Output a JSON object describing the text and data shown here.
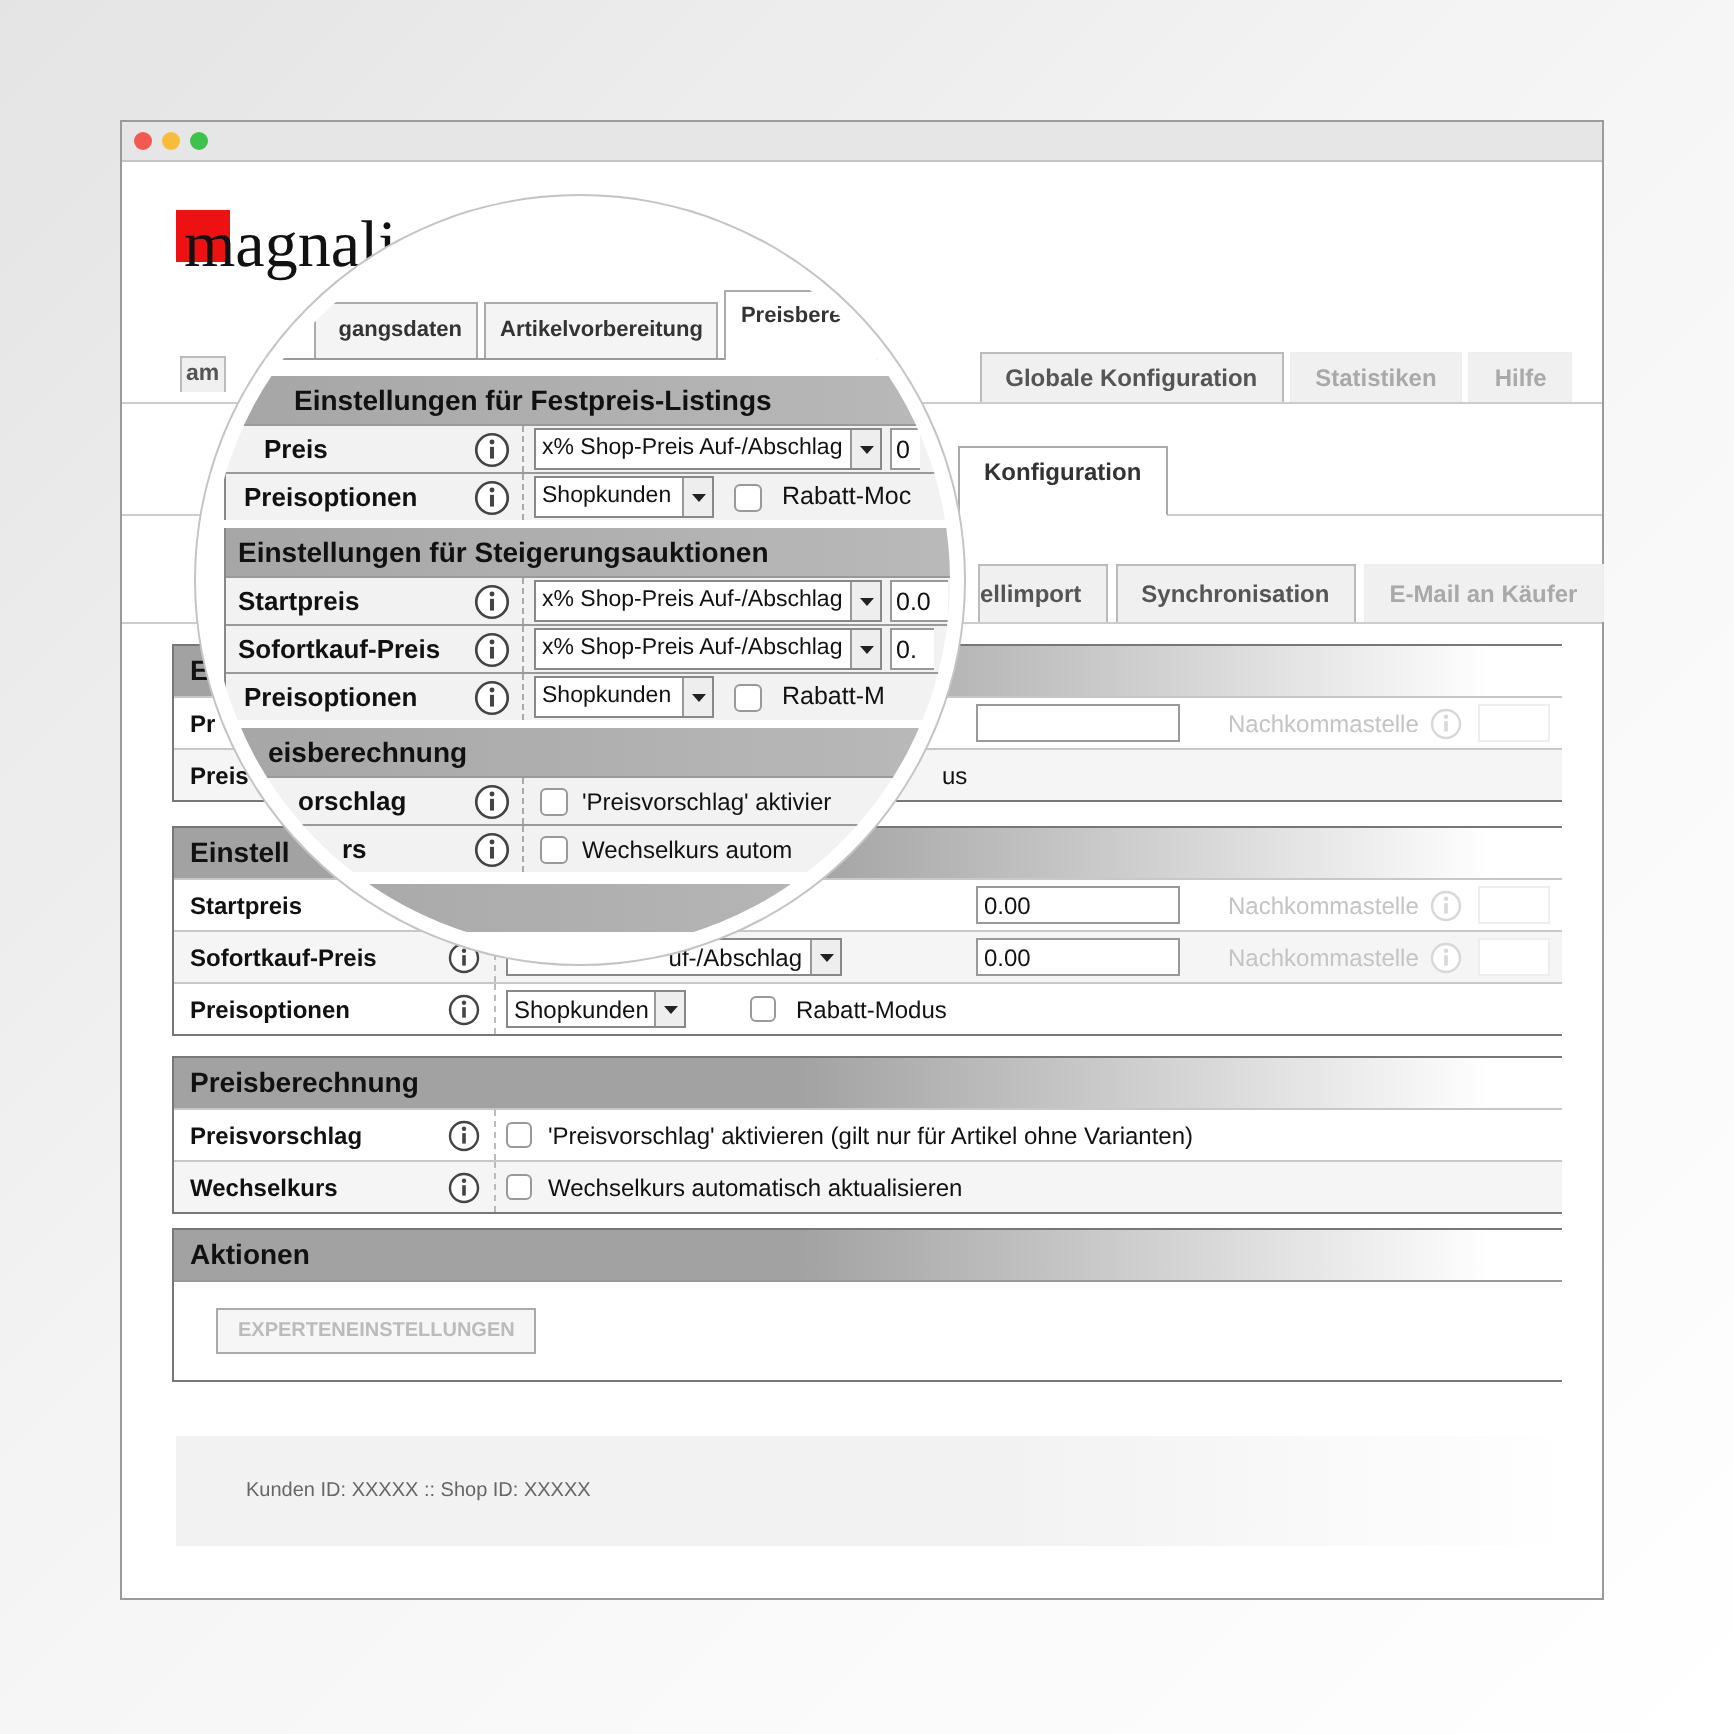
{
  "logo": {
    "text": "magnali"
  },
  "top_tabs": [
    {
      "label": "am",
      "selected": false,
      "faded": false
    },
    {
      "label": "Globale Konfiguration",
      "selected": false,
      "faded": false
    },
    {
      "label": "Statistiken",
      "selected": false,
      "faded": true
    },
    {
      "label": "Hilfe",
      "selected": false,
      "faded": true
    }
  ],
  "sub_tabs": [
    {
      "label": "Konfiguration",
      "selected": true
    }
  ],
  "section_tabs": [
    {
      "label": "ellimport",
      "selected": false,
      "faded": false
    },
    {
      "label": "Synchronisation",
      "selected": false,
      "faded": false
    },
    {
      "label": "E-Mail an Käufer",
      "selected": false,
      "faded": true
    }
  ],
  "sections": [
    {
      "title": "E",
      "rows": [
        {
          "label": "Pr",
          "kind": "field",
          "trailing_label": "Nachkommastelle"
        },
        {
          "label": "Preis",
          "kind": "text",
          "text": "us"
        }
      ]
    },
    {
      "title": "Einstell",
      "rows": [
        {
          "label": "Startpreis",
          "kind": "field",
          "value": "0.00",
          "trailing_label": "Nachkommastelle"
        },
        {
          "label": "Sofortkauf-Preis",
          "kind": "select_field",
          "select": "uf-/Abschlag",
          "value": "0.00",
          "trailing_label": "Nachkommastelle"
        },
        {
          "label": "Preisoptionen",
          "kind": "select_check",
          "select": "Shopkunden",
          "checked": false,
          "check_label": "Rabatt-Modus"
        }
      ]
    },
    {
      "title": "Preisberechnung",
      "rows": [
        {
          "label": "Preisvorschlag",
          "kind": "check",
          "checked": false,
          "check_label": "'Preisvorschlag' aktivieren (gilt nur für Artikel ohne Varianten)"
        },
        {
          "label": "Wechselkurs",
          "kind": "check",
          "checked": false,
          "check_label": "Wechselkurs automatisch aktualisieren"
        }
      ]
    },
    {
      "title": "Aktionen",
      "button": {
        "label": "EXPERTENEINSTELLUNGEN",
        "disabled": true
      }
    }
  ],
  "footer": {
    "text": "Kunden ID: XXXXX :: Shop ID: XXXXX"
  },
  "magnifier": {
    "tabs": [
      {
        "label": "gangsdaten",
        "selected": false
      },
      {
        "label": "Artikelvorbereitung",
        "selected": false
      },
      {
        "label": "Preisbere",
        "selected": true
      }
    ],
    "sections": [
      {
        "title": "Einstellungen für Festpreis-Listings",
        "rows": [
          {
            "label": "Preis",
            "kind": "select_field",
            "select": "x% Shop-Preis Auf-/Abschlag",
            "value": "0"
          },
          {
            "label": "Preisoptionen",
            "kind": "select_check",
            "select": "Shopkunden",
            "checked": false,
            "check_label": "Rabatt-Moc"
          }
        ]
      },
      {
        "title": "Einstellungen für Steigerungsauktionen",
        "rows": [
          {
            "label": "Startpreis",
            "kind": "select_field",
            "select": "x% Shop-Preis Auf-/Abschlag",
            "value": "0.0"
          },
          {
            "label": "Sofortkauf-Preis",
            "kind": "select_field",
            "select": "x% Shop-Preis Auf-/Abschlag",
            "value": "0."
          },
          {
            "label": "Preisoptionen",
            "kind": "select_check",
            "select": "Shopkunden",
            "checked": false,
            "check_label": "Rabatt-M"
          }
        ]
      },
      {
        "title": "eisberechnung",
        "rows": [
          {
            "label": "orschlag",
            "kind": "check",
            "checked": false,
            "check_label": "'Preisvorschlag' aktivier"
          },
          {
            "label": "rs",
            "kind": "check",
            "checked": false,
            "check_label": "Wechselkurs autom"
          }
        ]
      }
    ]
  }
}
